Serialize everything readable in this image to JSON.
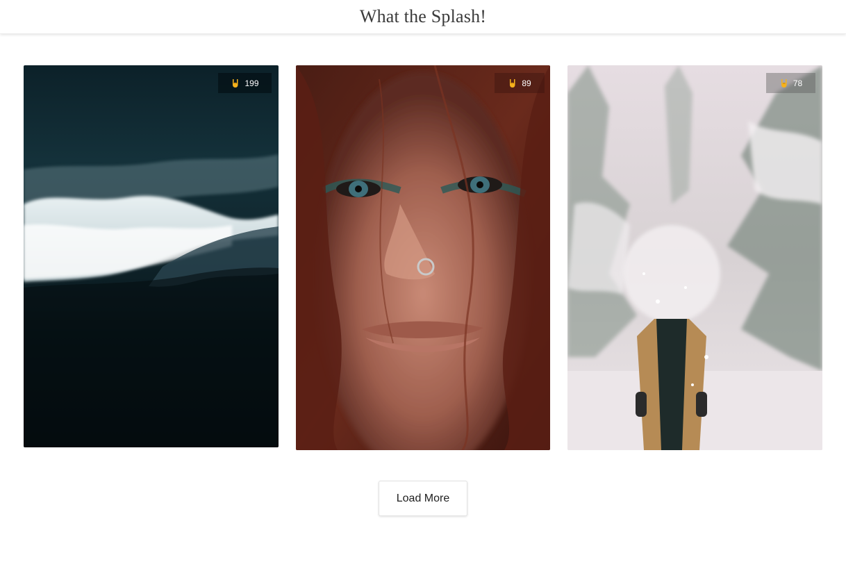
{
  "header": {
    "title": "What the Splash!"
  },
  "gallery": {
    "photos": [
      {
        "likes": "199",
        "subject": "aerial ocean waves on dark sand",
        "badge_icon": "rock-on-hand-icon"
      },
      {
        "likes": "89",
        "subject": "portrait of red-haired woman with freckles and nose ring",
        "badge_icon": "rock-on-hand-icon"
      },
      {
        "likes": "78",
        "subject": "person throwing snow in snowy forest",
        "badge_icon": "rock-on-hand-icon"
      }
    ]
  },
  "actions": {
    "load_more_label": "Load More"
  },
  "colors": {
    "badge_icon": "#f5b21d",
    "badge_text": "#ffffff"
  }
}
